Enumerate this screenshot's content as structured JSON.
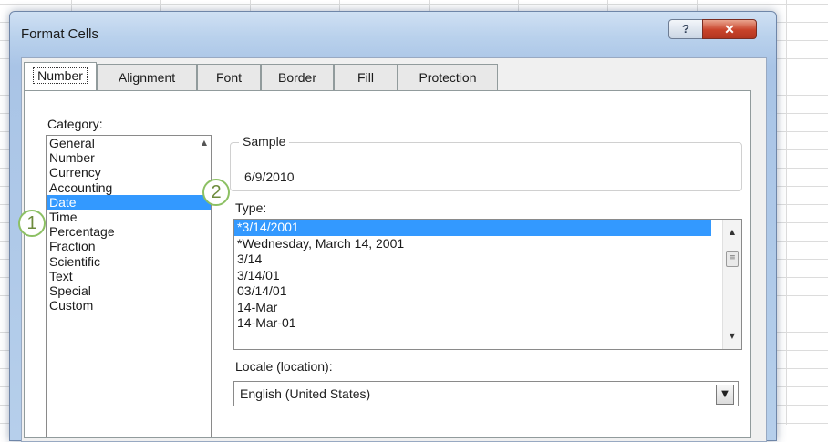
{
  "dialog": {
    "title": "Format Cells",
    "help_button": "?",
    "close_button": "✕"
  },
  "tabs": [
    {
      "label": "Number",
      "active": true
    },
    {
      "label": "Alignment",
      "active": false
    },
    {
      "label": "Font",
      "active": false
    },
    {
      "label": "Border",
      "active": false
    },
    {
      "label": "Fill",
      "active": false
    },
    {
      "label": "Protection",
      "active": false
    }
  ],
  "category": {
    "label": "Category:",
    "items": [
      "General",
      "Number",
      "Currency",
      "Accounting",
      "Date",
      "Time",
      "Percentage",
      "Fraction",
      "Scientific",
      "Text",
      "Special",
      "Custom"
    ],
    "selected": "Date"
  },
  "sample": {
    "label": "Sample",
    "value": "6/9/2010"
  },
  "type": {
    "label": "Type:",
    "items": [
      "*3/14/2001",
      "*Wednesday, March 14, 2001",
      "3/14",
      "3/14/01",
      "03/14/01",
      "14-Mar",
      "14-Mar-01"
    ],
    "selected": "*3/14/2001"
  },
  "locale": {
    "label": "Locale (location):",
    "value": "English (United States)"
  },
  "callouts": {
    "one": "1",
    "two": "2"
  },
  "colors": {
    "selection": "#3399ff",
    "callout_ring": "#8cc063",
    "close_button": "#c8432a"
  },
  "icons": {
    "help": "question-icon",
    "close": "close-icon",
    "dropdown": "chevron-down-icon"
  }
}
